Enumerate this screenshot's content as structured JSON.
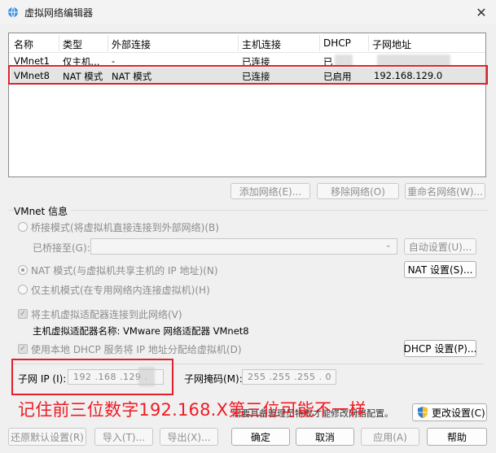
{
  "window": {
    "title": "虚拟网络编辑器",
    "close_glyph": "✕"
  },
  "table": {
    "headers": [
      "名称",
      "类型",
      "外部连接",
      "主机连接",
      "DHCP",
      "子网地址"
    ],
    "rows": [
      {
        "name": "VMnet1",
        "type": "仅主机...",
        "external": "-",
        "host": "已连接",
        "dhcp": "已",
        "subnet": ""
      },
      {
        "name": "VMnet8",
        "type": "NAT 模式",
        "external": "NAT 模式",
        "host": "已连接",
        "dhcp": "已启用",
        "subnet": "192.168.129.0"
      }
    ]
  },
  "list_buttons": {
    "add": "添加网络(E)...",
    "remove": "移除网络(O)",
    "rename": "重命名网络(W)..."
  },
  "vmnet_info": {
    "title": "VMnet 信息",
    "bridged": "桥接模式(将虚拟机直接连接到外部网络)(B)",
    "bridged_to_label": "已桥接至(G):",
    "auto_settings": "自动设置(U)...",
    "nat": "NAT 模式(与虚拟机共享主机的 IP 地址)(N)",
    "nat_settings": "NAT 设置(S)...",
    "hostonly": "仅主机模式(在专用网络内连接虚拟机)(H)",
    "connect_adapter": "将主机虚拟适配器连接到此网络(V)",
    "adapter_name_label": "主机虚拟适配器名称: VMware 网络适配器 VMnet8",
    "use_dhcp": "使用本地 DHCP 服务将 IP 地址分配给虚拟机(D)",
    "dhcp_settings": "DHCP 设置(P)...",
    "subnet_ip_label": "子网 IP (I):",
    "subnet_ip_value": "192 .168 .129 .",
    "subnet_mask_label": "子网掩码(M):",
    "subnet_mask_value": "255 .255 .255 . 0"
  },
  "admin_note": "需要具备管理员特权才能修改网络配置。",
  "change_settings": "更改设置(C)",
  "annotation": {
    "text": "记住前三位数字192.168.X第三位可能不一样",
    "color": "#ee1c25"
  },
  "footer_buttons": {
    "restore": "还原默认设置(R)",
    "import": "导入(T)...",
    "export": "导出(X)...",
    "ok": "确定",
    "cancel": "取消",
    "apply": "应用(A)",
    "help": "帮助"
  }
}
